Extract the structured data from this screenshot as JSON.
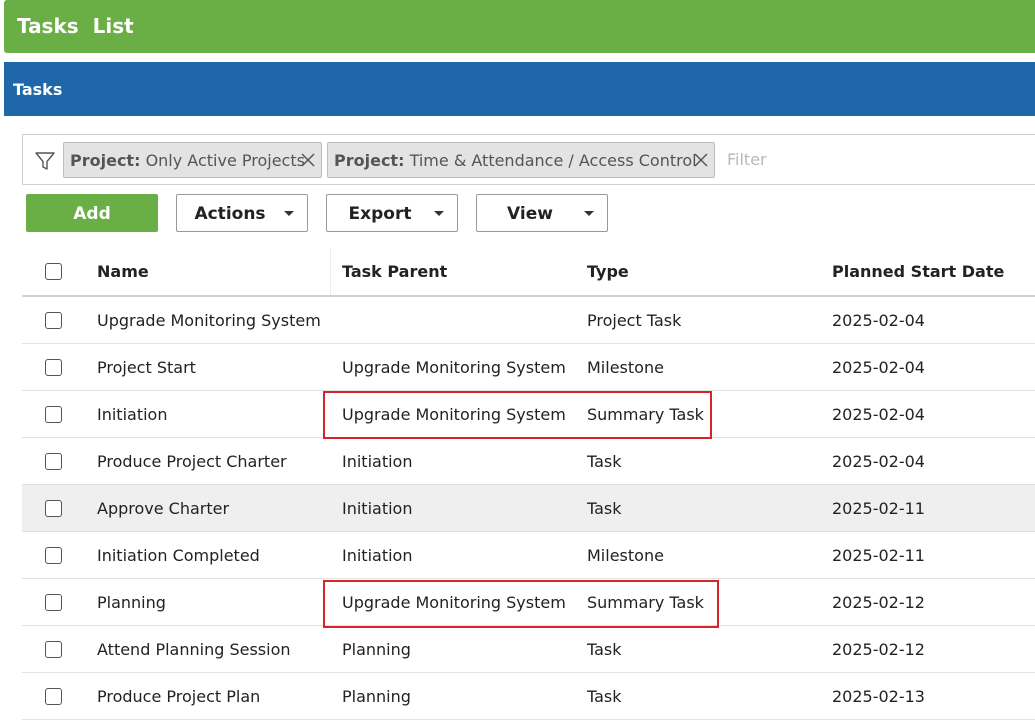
{
  "app": {
    "title": "Tasks  List"
  },
  "panel": {
    "title": "Tasks"
  },
  "filter": {
    "chips": [
      {
        "key": "Project:",
        "value": " Only Active Projects"
      },
      {
        "key": "Project:",
        "value": " Time & Attendance / Access Control"
      }
    ],
    "placeholder": "Filter"
  },
  "toolbar": {
    "add_label": "Add",
    "actions_label": "Actions",
    "export_label": "Export",
    "view_label": "View"
  },
  "table": {
    "columns": [
      "Name",
      "Task Parent",
      "Type",
      "Planned Start Date"
    ],
    "rows": [
      {
        "name": "Upgrade Monitoring System",
        "parent": "",
        "type": "Project Task",
        "date": "2025-02-04"
      },
      {
        "name": "Project Start",
        "parent": "Upgrade Monitoring System",
        "type": "Milestone",
        "date": "2025-02-04"
      },
      {
        "name": "Initiation",
        "parent": "Upgrade Monitoring System",
        "type": "Summary Task",
        "date": "2025-02-04"
      },
      {
        "name": "Produce Project Charter",
        "parent": "Initiation",
        "type": "Task",
        "date": "2025-02-04"
      },
      {
        "name": "Approve Charter",
        "parent": "Initiation",
        "type": "Task",
        "date": "2025-02-11"
      },
      {
        "name": "Initiation Completed",
        "parent": "Initiation",
        "type": "Milestone",
        "date": "2025-02-11"
      },
      {
        "name": "Planning",
        "parent": "Upgrade Monitoring System",
        "type": "Summary Task",
        "date": "2025-02-12"
      },
      {
        "name": "Attend Planning Session",
        "parent": "Planning",
        "type": "Task",
        "date": "2025-02-12"
      },
      {
        "name": "Produce Project Plan",
        "parent": "Planning",
        "type": "Task",
        "date": "2025-02-13"
      }
    ]
  },
  "colors": {
    "header_green": "#6aaf45",
    "panel_blue": "#2067aa",
    "highlight_red": "#d6242a"
  }
}
